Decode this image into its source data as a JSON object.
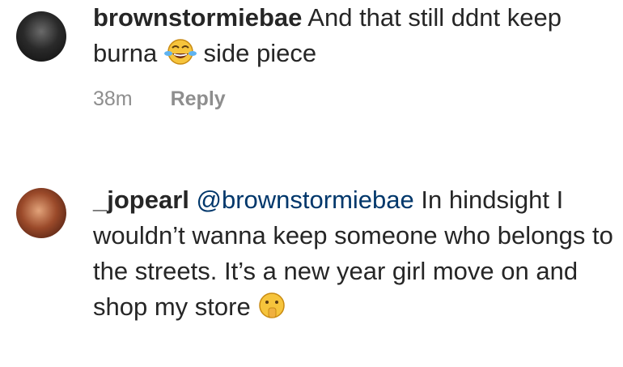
{
  "comments": [
    {
      "username": "brownstormiebae",
      "text_before_emoji": "And that still ddnt keep burna",
      "emoji": "face-with-tears-of-joy",
      "text_after_emoji": "side piece",
      "time": "38m",
      "reply_label": "Reply"
    },
    {
      "username": "_jopearl",
      "mention": "@brownstormiebae",
      "text_before_emoji": "In hindsight I wouldn’t wanna keep someone who belongs to the streets. It’s a new year girl move on and shop my store",
      "emoji": "face-with-hand-over-mouth"
    }
  ]
}
